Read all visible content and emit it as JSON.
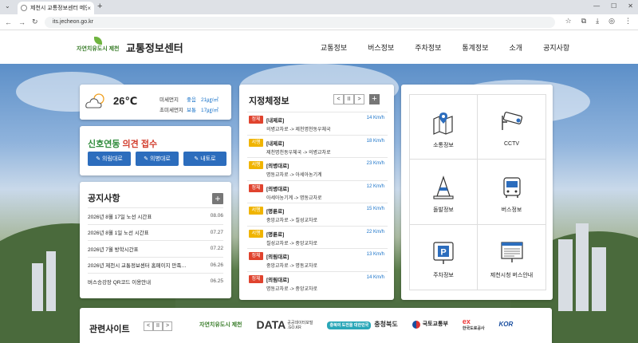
{
  "browser": {
    "tab_title": "제천시 교통정보센터 메인",
    "url": "its.jecheon.go.kr"
  },
  "header": {
    "logo_text": "자연치유도시 제천",
    "title": "교통정보센터",
    "nav": [
      "교통정보",
      "버스정보",
      "주차정보",
      "통계정보",
      "소개",
      "공지사항"
    ]
  },
  "weather": {
    "temperature": "26℃",
    "fine_dust": {
      "label": "미세먼지",
      "status": "좋음",
      "value": "21㎍/㎥"
    },
    "ultrafine_dust": {
      "label": "초미세먼지",
      "status": "보통",
      "value": "17㎍/㎥"
    }
  },
  "complaint": {
    "title_green": "신호연동",
    "title_red": "의견 접수",
    "buttons": [
      "의림대로",
      "의병대로",
      "내토로"
    ]
  },
  "notice": {
    "title": "공지사항",
    "plus": "+",
    "items": [
      {
        "title": "2026년 8월 17일 노선 시간표",
        "date": "08.06"
      },
      {
        "title": "2026년 8월 1일 노선 시간표",
        "date": "07.27"
      },
      {
        "title": "2026년 7월 방학시간표",
        "date": "07.22"
      },
      {
        "title": "2026년 제천시 교통정보센터 홈페이지 만족…",
        "date": "06.26"
      },
      {
        "title": "버스승강장 QR코드 이용안내",
        "date": "06.25"
      }
    ]
  },
  "congestion": {
    "title": "지정체정보",
    "controls": {
      "prev": "<",
      "pause": "II",
      "next": ">",
      "add": "+"
    },
    "items": [
      {
        "status": "정체",
        "color": "red",
        "road": "[내제로]",
        "section": "의병교차로 -> 제천명천동우체국",
        "speed": "14 Km/h"
      },
      {
        "status": "서행",
        "color": "yellow",
        "road": "[내제로]",
        "section": "제천명천동우체국 -> 의병교차로",
        "speed": "18 Km/h"
      },
      {
        "status": "서행",
        "color": "yellow",
        "road": "[의병대로]",
        "section": "명동교차로 -> 아세아농기계",
        "speed": "23 Km/h"
      },
      {
        "status": "정체",
        "color": "red",
        "road": "[의병대로]",
        "section": "아세아농기계 -> 명동교차로",
        "speed": "12 Km/h"
      },
      {
        "status": "서행",
        "color": "yellow",
        "road": "[명륜로]",
        "section": "중앙교차로 -> 칠성교차로",
        "speed": "15 Km/h"
      },
      {
        "status": "서행",
        "color": "yellow",
        "road": "[명륜로]",
        "section": "칠성교차로 -> 중앙교차로",
        "speed": "22 Km/h"
      },
      {
        "status": "정체",
        "color": "red",
        "road": "[의림대로]",
        "section": "중앙교차로 -> 명동교차로",
        "speed": "13 Km/h"
      },
      {
        "status": "정체",
        "color": "red",
        "road": "[의림대로]",
        "section": "명동교차로 -> 중앙교차로",
        "speed": "14 Km/h"
      }
    ]
  },
  "menu": {
    "items": [
      {
        "label": "소통정보",
        "icon": "map-pin-icon"
      },
      {
        "label": "CCTV",
        "icon": "cctv-icon"
      },
      {
        "label": "돌발정보",
        "icon": "traffic-cone-icon"
      },
      {
        "label": "버스정보",
        "icon": "bus-icon"
      },
      {
        "label": "주차정보",
        "icon": "parking-icon"
      },
      {
        "label": "제천시청 버스안내",
        "icon": "bus-info-board-icon"
      }
    ]
  },
  "related": {
    "title": "관련사이트",
    "controls": {
      "prev": "<",
      "pause": "II",
      "next": ">"
    },
    "sites": {
      "jecheon": "자연치유도시 제천",
      "data_main": "DATA",
      "data_sub1": "공공데이터포털",
      "data_sub2": ".GO.KR",
      "chungbuk_tag": "충북의 도전을 대한민국",
      "chungbuk": "충청북도",
      "molit": "국토교통부",
      "ex_main": "ex",
      "ex_sub": "한국도로공사",
      "kor": "KOR"
    }
  }
}
